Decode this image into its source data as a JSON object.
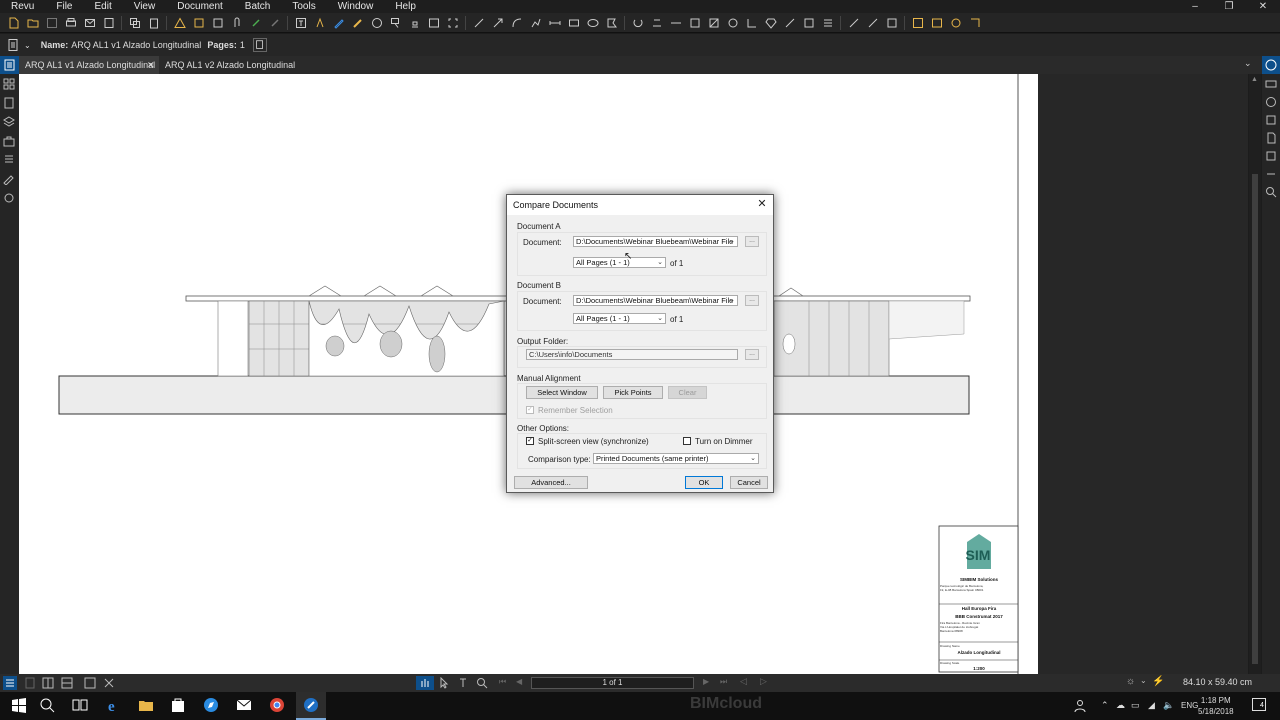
{
  "menu": {
    "items": [
      "Revu",
      "File",
      "Edit",
      "View",
      "Document",
      "Batch",
      "Tools",
      "Window",
      "Help"
    ]
  },
  "window_controls": {
    "minimize": "–",
    "restore": "❐",
    "close": "✕"
  },
  "namebar": {
    "name_label": "Name:",
    "name_value": "ARQ AL1 v1 Alzado Longitudinal",
    "pages_label": "Pages:",
    "pages_value": "1"
  },
  "tabs": [
    {
      "label": "ARQ AL1 v1 Alzado Longitudinal",
      "active": true,
      "close": "✕"
    },
    {
      "label": "ARQ AL1 v2 Alzado Longitudinal",
      "active": false
    }
  ],
  "dialog": {
    "title": "Compare Documents",
    "close": "✕",
    "doc_a": {
      "group_label": "Document A",
      "document_label": "Document:",
      "document_value": "D:\\Documents\\Webinar Bluebeam\\Webinar File",
      "pages_value": "All Pages (1 - 1)",
      "of_label": "of 1",
      "browse": "..."
    },
    "doc_b": {
      "group_label": "Document B",
      "document_label": "Document:",
      "document_value": "D:\\Documents\\Webinar Bluebeam\\Webinar File",
      "pages_value": "All Pages (1 - 1)",
      "of_label": "of 1",
      "browse": "..."
    },
    "output": {
      "label": "Output Folder:",
      "value": "C:\\Users\\info\\Documents",
      "browse": "..."
    },
    "manual": {
      "label": "Manual Alignment",
      "select_window": "Select Window",
      "pick_points": "Pick Points",
      "clear": "Clear",
      "remember": "Remember Selection"
    },
    "other": {
      "label": "Other Options:",
      "split_screen": "Split-screen view (synchronize)",
      "split_checked": true,
      "dimmer": "Turn on Dimmer",
      "dimmer_checked": false,
      "comparison_label": "Comparison type:",
      "comparison_value": "Printed Documents (same printer)"
    },
    "advanced": "Advanced...",
    "ok": "OK",
    "cancel": "Cancel"
  },
  "titleblock": {
    "company": "SIMBIM Solutions",
    "address": "Parque tecnològic de Barcelona, 19, E-08 Barcelona Spain 08001",
    "project": "Hall Europa Fira",
    "event": "BBB Construmat 2017",
    "location": "Fira Barcelona - Recinte Gran Via L'Hospitalet de Llobregat Barcelona 08908",
    "drawing_name_label": "Drawing Name",
    "drawing_name": "Alzado Longitudinal",
    "scale_label": "Drawing Scale",
    "scale": "1:200"
  },
  "status": {
    "page_indicator": "1 of 1",
    "size": "84.10 x 59.40 cm"
  },
  "taskbar": {
    "lang": "ENG",
    "time": "1:18 PM",
    "date": "5/18/2018",
    "notification_count": "4",
    "watermark": "BIMcloud"
  }
}
